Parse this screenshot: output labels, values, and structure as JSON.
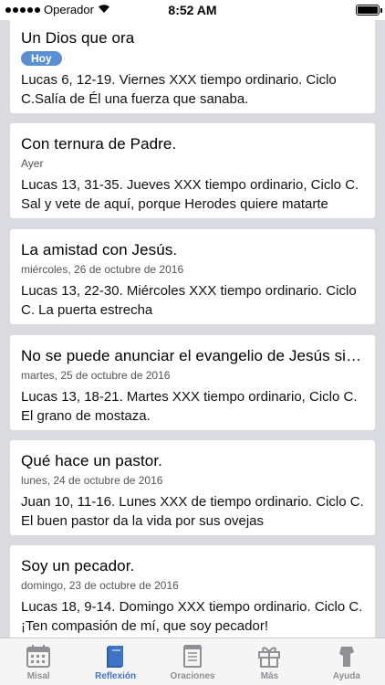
{
  "status": {
    "carrier": "Operador",
    "time": "8:52 AM"
  },
  "reflections": [
    {
      "title": "Un Dios que ora",
      "badge": "Hoy",
      "date": "",
      "summary": "Lucas 6, 12-19. Viernes XXX tiempo ordinario. Ciclo C.Salía de Él una fuerza que sanaba."
    },
    {
      "title": "Con ternura de Padre.",
      "badge": "",
      "date": "Ayer",
      "summary": "Lucas 13, 31-35. Jueves XXX tiempo ordinario, Ciclo C. Sal y vete de aquí, porque Herodes quiere matarte"
    },
    {
      "title": "La amistad con Jesús.",
      "badge": "",
      "date": "miércoles, 26 de octubre de 2016",
      "summary": "Lucas 13, 22-30. Miércoles XXX tiempo ordinario. Ciclo C. La puerta estrecha"
    },
    {
      "title": "No se puede anunciar el evangelio de Jesús sin…",
      "badge": "",
      "date": "martes, 25 de octubre de 2016",
      "summary": "Lucas 13, 18-21. Martes XXX tiempo ordinario, Ciclo C. El grano de mostaza."
    },
    {
      "title": "Qué hace un pastor.",
      "badge": "",
      "date": "lunes, 24 de octubre de 2016",
      "summary": "Juan 10, 11-16. Lunes XXX de tiempo ordinario. Ciclo C. El buen pastor da la vida por sus ovejas"
    },
    {
      "title": "Soy un pecador.",
      "badge": "",
      "date": "domingo, 23 de octubre de 2016",
      "summary": "Lucas 18, 9-14. Domingo XXX tiempo ordinario. Ciclo C. ¡Ten compasión de mí, que soy pecador!"
    }
  ],
  "tabbar": {
    "tabs": [
      {
        "label": "Misal",
        "icon": "calendar-icon"
      },
      {
        "label": "Reflexión",
        "icon": "book-icon"
      },
      {
        "label": "Oraciones",
        "icon": "notepad-icon"
      },
      {
        "label": "Más",
        "icon": "gift-icon"
      },
      {
        "label": "Ayuda",
        "icon": "help-person-icon"
      }
    ],
    "active_index": 1,
    "active_color": "#3f73c6",
    "inactive_color": "#8f9094"
  },
  "colors": {
    "background": "#d9dbe0",
    "badge": "#5b8fd3"
  }
}
